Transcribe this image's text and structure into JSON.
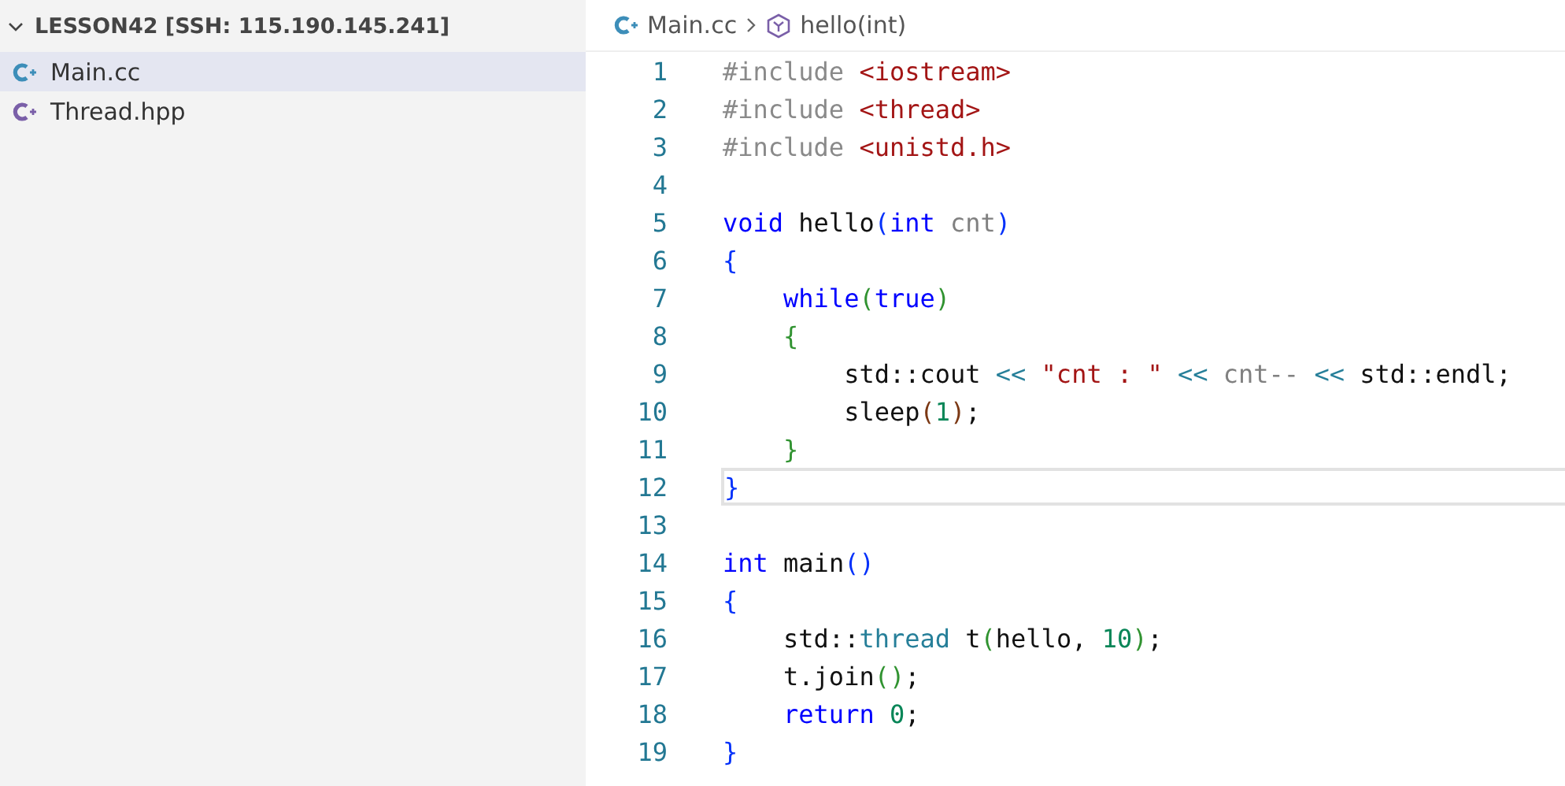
{
  "explorer": {
    "folder": "LESSON42 [SSH: 115.190.145.241]",
    "expanded": true,
    "files": [
      {
        "name": "Main.cc",
        "selected": true
      },
      {
        "name": "Thread.hpp",
        "selected": false
      }
    ]
  },
  "breadcrumb": {
    "file": "Main.cc",
    "symbol": "hello(int)"
  },
  "editor": {
    "lines": [
      {
        "number": "1",
        "current": false,
        "tokens": [
          {
            "text": "#include ",
            "kind": "preprocessor"
          },
          {
            "text": "<iostream>",
            "kind": "string"
          }
        ]
      },
      {
        "number": "2",
        "current": false,
        "tokens": [
          {
            "text": "#include ",
            "kind": "preprocessor"
          },
          {
            "text": "<thread>",
            "kind": "string"
          }
        ]
      },
      {
        "number": "3",
        "current": false,
        "tokens": [
          {
            "text": "#include ",
            "kind": "preprocessor"
          },
          {
            "text": "<unistd.h>",
            "kind": "string"
          }
        ]
      },
      {
        "number": "4",
        "current": false
      },
      {
        "number": "5",
        "current": false,
        "tokens": [
          {
            "text": "void",
            "kind": "keyword"
          },
          {
            "text": " hello",
            "kind": "plain"
          },
          {
            "text": "(",
            "kind": "bracket1"
          },
          {
            "text": "int",
            "kind": "keyword"
          },
          {
            "text": " cnt",
            "kind": "parameter"
          },
          {
            "text": ")",
            "kind": "bracket1"
          }
        ]
      },
      {
        "number": "6",
        "current": false,
        "tokens": [
          {
            "text": "{",
            "kind": "bracket1"
          }
        ]
      },
      {
        "number": "7",
        "current": false,
        "tokens": [
          {
            "text": "    while",
            "kind": "keyword"
          },
          {
            "text": "(",
            "kind": "bracket2"
          },
          {
            "text": "true",
            "kind": "keyword"
          },
          {
            "text": ")",
            "kind": "bracket2"
          }
        ]
      },
      {
        "number": "8",
        "current": false,
        "tokens": [
          {
            "text": "    {",
            "kind": "bracket2"
          }
        ]
      },
      {
        "number": "9",
        "current": false,
        "tokens": [
          {
            "text": "        std::cout ",
            "kind": "plain"
          },
          {
            "text": "<< ",
            "kind": "operator"
          },
          {
            "text": "\"cnt : \" ",
            "kind": "string"
          },
          {
            "text": "<<",
            "kind": "operator"
          },
          {
            "text": " cnt-- ",
            "kind": "parameter"
          },
          {
            "text": "<<",
            "kind": "operator"
          },
          {
            "text": " std::endl;",
            "kind": "plain"
          }
        ]
      },
      {
        "number": "10",
        "current": false,
        "tokens": [
          {
            "text": "        sleep",
            "kind": "plain"
          },
          {
            "text": "(",
            "kind": "bracket3"
          },
          {
            "text": "1",
            "kind": "number"
          },
          {
            "text": ")",
            "kind": "bracket3"
          },
          {
            "text": ";",
            "kind": "plain"
          }
        ]
      },
      {
        "number": "11",
        "current": false,
        "tokens": [
          {
            "text": "    }",
            "kind": "bracket2"
          }
        ]
      },
      {
        "number": "12",
        "current": true,
        "tokens": [
          {
            "text": "}",
            "kind": "bracket1"
          }
        ]
      },
      {
        "number": "13",
        "current": false
      },
      {
        "number": "14",
        "current": false,
        "tokens": [
          {
            "text": "int",
            "kind": "keyword"
          },
          {
            "text": " main",
            "kind": "plain"
          },
          {
            "text": "()",
            "kind": "bracket1"
          }
        ]
      },
      {
        "number": "15",
        "current": false,
        "tokens": [
          {
            "text": "{",
            "kind": "bracket1"
          }
        ]
      },
      {
        "number": "16",
        "current": false,
        "tokens": [
          {
            "text": "    std::",
            "kind": "plain"
          },
          {
            "text": "thread",
            "kind": "type"
          },
          {
            "text": " t",
            "kind": "plain"
          },
          {
            "text": "(",
            "kind": "bracket2"
          },
          {
            "text": "hello, ",
            "kind": "plain"
          },
          {
            "text": "10",
            "kind": "number"
          },
          {
            "text": ")",
            "kind": "bracket2"
          },
          {
            "text": ";",
            "kind": "plain"
          }
        ]
      },
      {
        "number": "17",
        "current": false,
        "tokens": [
          {
            "text": "    t.join",
            "kind": "plain"
          },
          {
            "text": "()",
            "kind": "bracket2"
          },
          {
            "text": ";",
            "kind": "plain"
          }
        ]
      },
      {
        "number": "18",
        "current": false,
        "tokens": [
          {
            "text": "    return ",
            "kind": "keyword"
          },
          {
            "text": "0",
            "kind": "number"
          },
          {
            "text": ";",
            "kind": "plain"
          }
        ]
      },
      {
        "number": "19",
        "current": false,
        "tokens": [
          {
            "text": "}",
            "kind": "bracket1"
          }
        ]
      }
    ]
  }
}
